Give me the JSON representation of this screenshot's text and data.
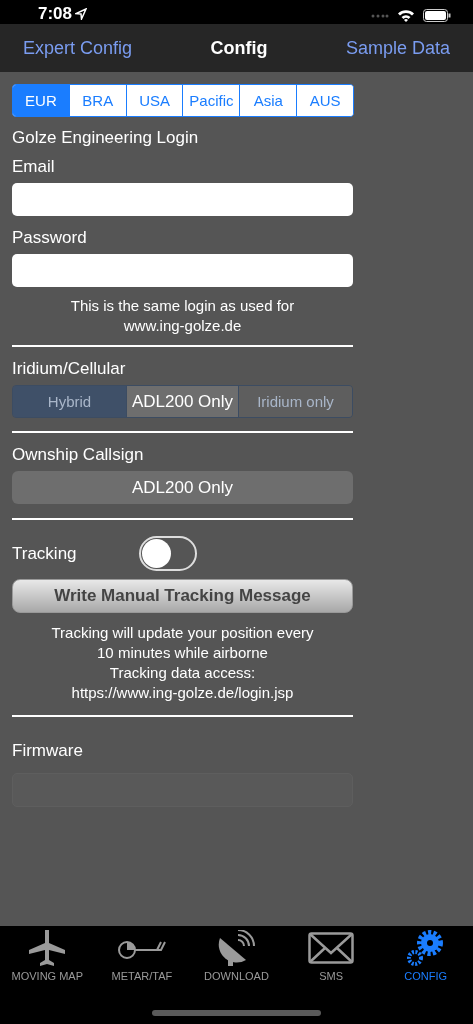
{
  "status_bar": {
    "time": "7:08"
  },
  "nav": {
    "left": "Expert Config",
    "title": "Config",
    "right": "Sample Data"
  },
  "regions": [
    {
      "label": "EUR",
      "selected": true
    },
    {
      "label": "BRA",
      "selected": false
    },
    {
      "label": "USA",
      "selected": false
    },
    {
      "label": "Pacific",
      "selected": false
    },
    {
      "label": "Asia",
      "selected": false
    },
    {
      "label": "AUS",
      "selected": false
    }
  ],
  "login": {
    "heading": "Golze Engineering Login",
    "email_label": "Email",
    "password_label": "Password",
    "note": [
      "This is the same login as used for",
      "www.ing-golze.de"
    ]
  },
  "iridium": {
    "label": "Iridium/Cellular",
    "disabled": true,
    "overlay": "ADL200 Only",
    "segments": [
      {
        "label": "Hybrid",
        "selected": true
      },
      {
        "label": "Iridium only",
        "selected": false
      }
    ]
  },
  "callsign": {
    "label": "Ownship Callsign",
    "value": "ADL200 Only"
  },
  "tracking": {
    "label": "Tracking",
    "on": false,
    "button": "Write Manual Tracking Message",
    "note": [
      "Tracking will update your position every",
      "10 minutes while airborne",
      "Tracking data access:",
      "https://www.ing-golze.de/login.jsp"
    ]
  },
  "firmware": {
    "label": "Firmware"
  },
  "tab_bar": [
    {
      "label": "MOVING MAP",
      "kind": "plane",
      "selected": false
    },
    {
      "label": "METAR/TAF",
      "kind": "wind",
      "selected": false
    },
    {
      "label": "DOWNLOAD",
      "kind": "dish",
      "selected": false
    },
    {
      "label": "SMS",
      "kind": "mail",
      "selected": false
    },
    {
      "label": "CONFIG",
      "kind": "gear",
      "selected": true
    }
  ]
}
